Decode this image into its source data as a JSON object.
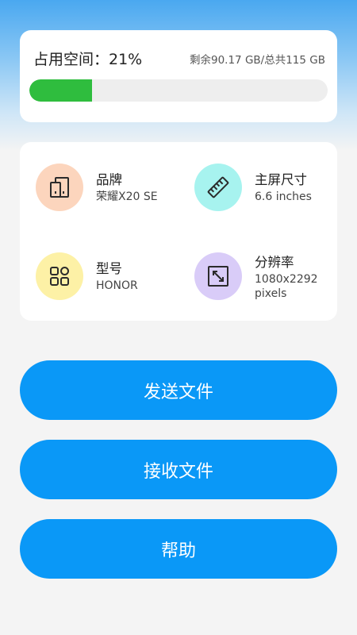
{
  "storage": {
    "title": "占用空间：21%",
    "detail": "剩余90.17 GB/总共115 GB",
    "used_fraction": 0.21,
    "bar_color": "#2fbd3e"
  },
  "device_info": {
    "brand": {
      "label": "品牌",
      "value": "荣耀X20 SE",
      "icon": "phone-icon",
      "color": "#fcd5bd"
    },
    "screen_size": {
      "label": "主屏尺寸",
      "value": "6.6 inches",
      "icon": "ruler-icon",
      "color": "#a7f3ef"
    },
    "model": {
      "label": "型号",
      "value": "HONOR",
      "icon": "grid-icon",
      "color": "#fdf1a6"
    },
    "resolution": {
      "label": "分辨率",
      "value_line1": "1080x2292",
      "value_line2": "pixels",
      "icon": "resize-icon",
      "color": "#d9ccf8"
    }
  },
  "actions": {
    "send_label": "发送文件",
    "receive_label": "接收文件",
    "help_label": "帮助",
    "button_color": "#0a98f7"
  }
}
